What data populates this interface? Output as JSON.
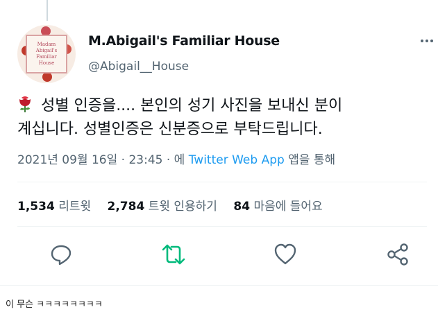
{
  "tweet": {
    "display_name": "M.Abigail's Familiar House",
    "handle": "@Abigail__House",
    "avatar_text": [
      "Madam",
      "Abigail's",
      "Familiar",
      "House"
    ],
    "text_line1": "성별 인증을.... 본인의 성기 사진을 보내신 분이",
    "text_line2": "계십니다. 성별인증은 신분증으로 부탁드립니다.",
    "timestamp": "2021년 09월 16일 · 23:45 · 에",
    "source": "Twitter Web App",
    "source_suffix": "앱을 통해"
  },
  "stats": {
    "retweets_count": "1,534",
    "retweets_label": "리트윗",
    "quotes_count": "2,784",
    "quotes_label": "트윗 인용하기",
    "likes_count": "84",
    "likes_label": "마음에 들어요"
  },
  "actions": {
    "icons": [
      "reply-icon",
      "retweet-icon",
      "like-icon",
      "share-icon"
    ]
  },
  "colors": {
    "accent": "#1d9bf0",
    "retweet": "#00ba7c",
    "muted": "#536471"
  },
  "caption": "이 무슨 ㅋㅋㅋㅋㅋㅋㅋㅋ"
}
